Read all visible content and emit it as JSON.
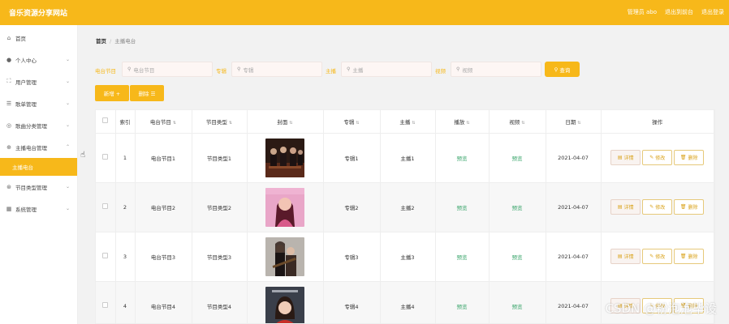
{
  "app": {
    "title": "音乐资源分享网站"
  },
  "topbar": {
    "admin": "管理员 abo",
    "back_to_front": "退出到前台",
    "logout": "退出登录"
  },
  "sidebar": {
    "items": [
      {
        "label": "首页",
        "icon": "home-icon",
        "has_arrow": false
      },
      {
        "label": "个人中心",
        "icon": "user-icon",
        "has_arrow": true
      },
      {
        "label": "用户管理",
        "icon": "users-icon",
        "has_arrow": true
      },
      {
        "label": "歌单管理",
        "icon": "playlist-icon",
        "has_arrow": true
      },
      {
        "label": "歌曲分类管理",
        "icon": "category-icon",
        "has_arrow": true
      },
      {
        "label": "主播电台管理",
        "icon": "radio-icon",
        "has_arrow": true,
        "expanded": true
      },
      {
        "label": "节目类型管理",
        "icon": "program-type-icon",
        "has_arrow": true
      },
      {
        "label": "系统管理",
        "icon": "system-icon",
        "has_arrow": true
      }
    ],
    "active_sub": "主播电台"
  },
  "breadcrumb": {
    "home": "首页",
    "separator": "/",
    "current": "主播电台"
  },
  "search": {
    "fields": [
      {
        "label": "电台节目",
        "placeholder": "电台节目"
      },
      {
        "label": "专辑",
        "placeholder": "专辑"
      },
      {
        "label": "主播",
        "placeholder": "主播"
      },
      {
        "label": "视频",
        "placeholder": "视频"
      }
    ],
    "query_label": "查询"
  },
  "actions": {
    "add": "新增 +",
    "delete": "删除 ☰"
  },
  "table": {
    "headers": [
      "",
      "索引",
      "电台节目",
      "节目类型",
      "封面",
      "专辑",
      "主播",
      "播放",
      "视频",
      "日期",
      "操作"
    ],
    "rows": [
      {
        "index": "1",
        "program": "电台节目1",
        "type": "节目类型1",
        "album": "专辑1",
        "host": "主播1",
        "play": "预览",
        "video": "预览",
        "date": "2021-04-07"
      },
      {
        "index": "2",
        "program": "电台节目2",
        "type": "节目类型2",
        "album": "专辑2",
        "host": "主播2",
        "play": "预览",
        "video": "预览",
        "date": "2021-04-07"
      },
      {
        "index": "3",
        "program": "电台节目3",
        "type": "节目类型3",
        "album": "专辑3",
        "host": "主播3",
        "play": "预览",
        "video": "预览",
        "date": "2021-04-07"
      },
      {
        "index": "4",
        "program": "电台节目4",
        "type": "节目类型4",
        "album": "专辑4",
        "host": "主播4",
        "play": "预览",
        "video": "预览",
        "date": "2021-04-07"
      }
    ],
    "op_labels": {
      "detail": "详情",
      "edit": "修改",
      "delete": "删除"
    }
  },
  "watermark": "CSDN @粉泡泡毕设",
  "colors": {
    "accent": "#f7b81a",
    "preview": "#3aa56b"
  }
}
